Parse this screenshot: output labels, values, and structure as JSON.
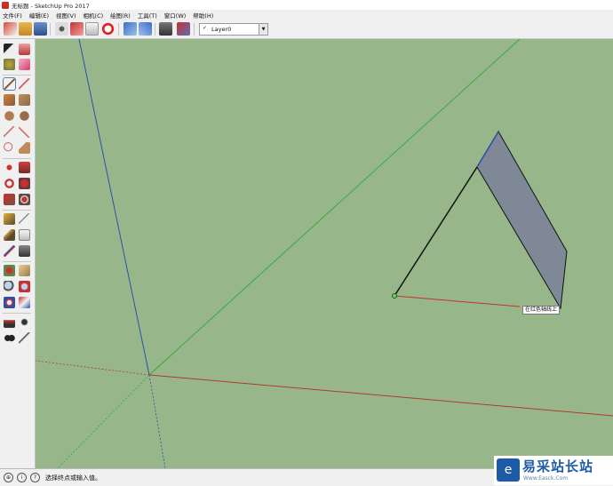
{
  "window": {
    "title": "无标题 - SketchUp Pro 2017"
  },
  "menu": [
    "文件(F)",
    "编辑(E)",
    "视图(V)",
    "相机(C)",
    "绘图(R)",
    "工具(T)",
    "窗口(W)",
    "帮助(H)"
  ],
  "toolbar": {
    "layer": {
      "check": "✓",
      "name": "Layer0",
      "dropdown": "▼"
    }
  },
  "viewport": {
    "tooltip": "在红色轴线上",
    "colors": {
      "background": "#97b78a",
      "red_axis": "#b23a2a",
      "green_axis": "#2fa83a",
      "blue_axis": "#2c4fa8",
      "face": "#7e8896"
    }
  },
  "status": {
    "icons": [
      "geo-icon",
      "info-icon",
      "help-icon"
    ],
    "hint": "选择终点或输入值。"
  },
  "watermark": {
    "logo_glyph": "e",
    "text": "易采站长站",
    "url": "Www.Easck.Com"
  }
}
